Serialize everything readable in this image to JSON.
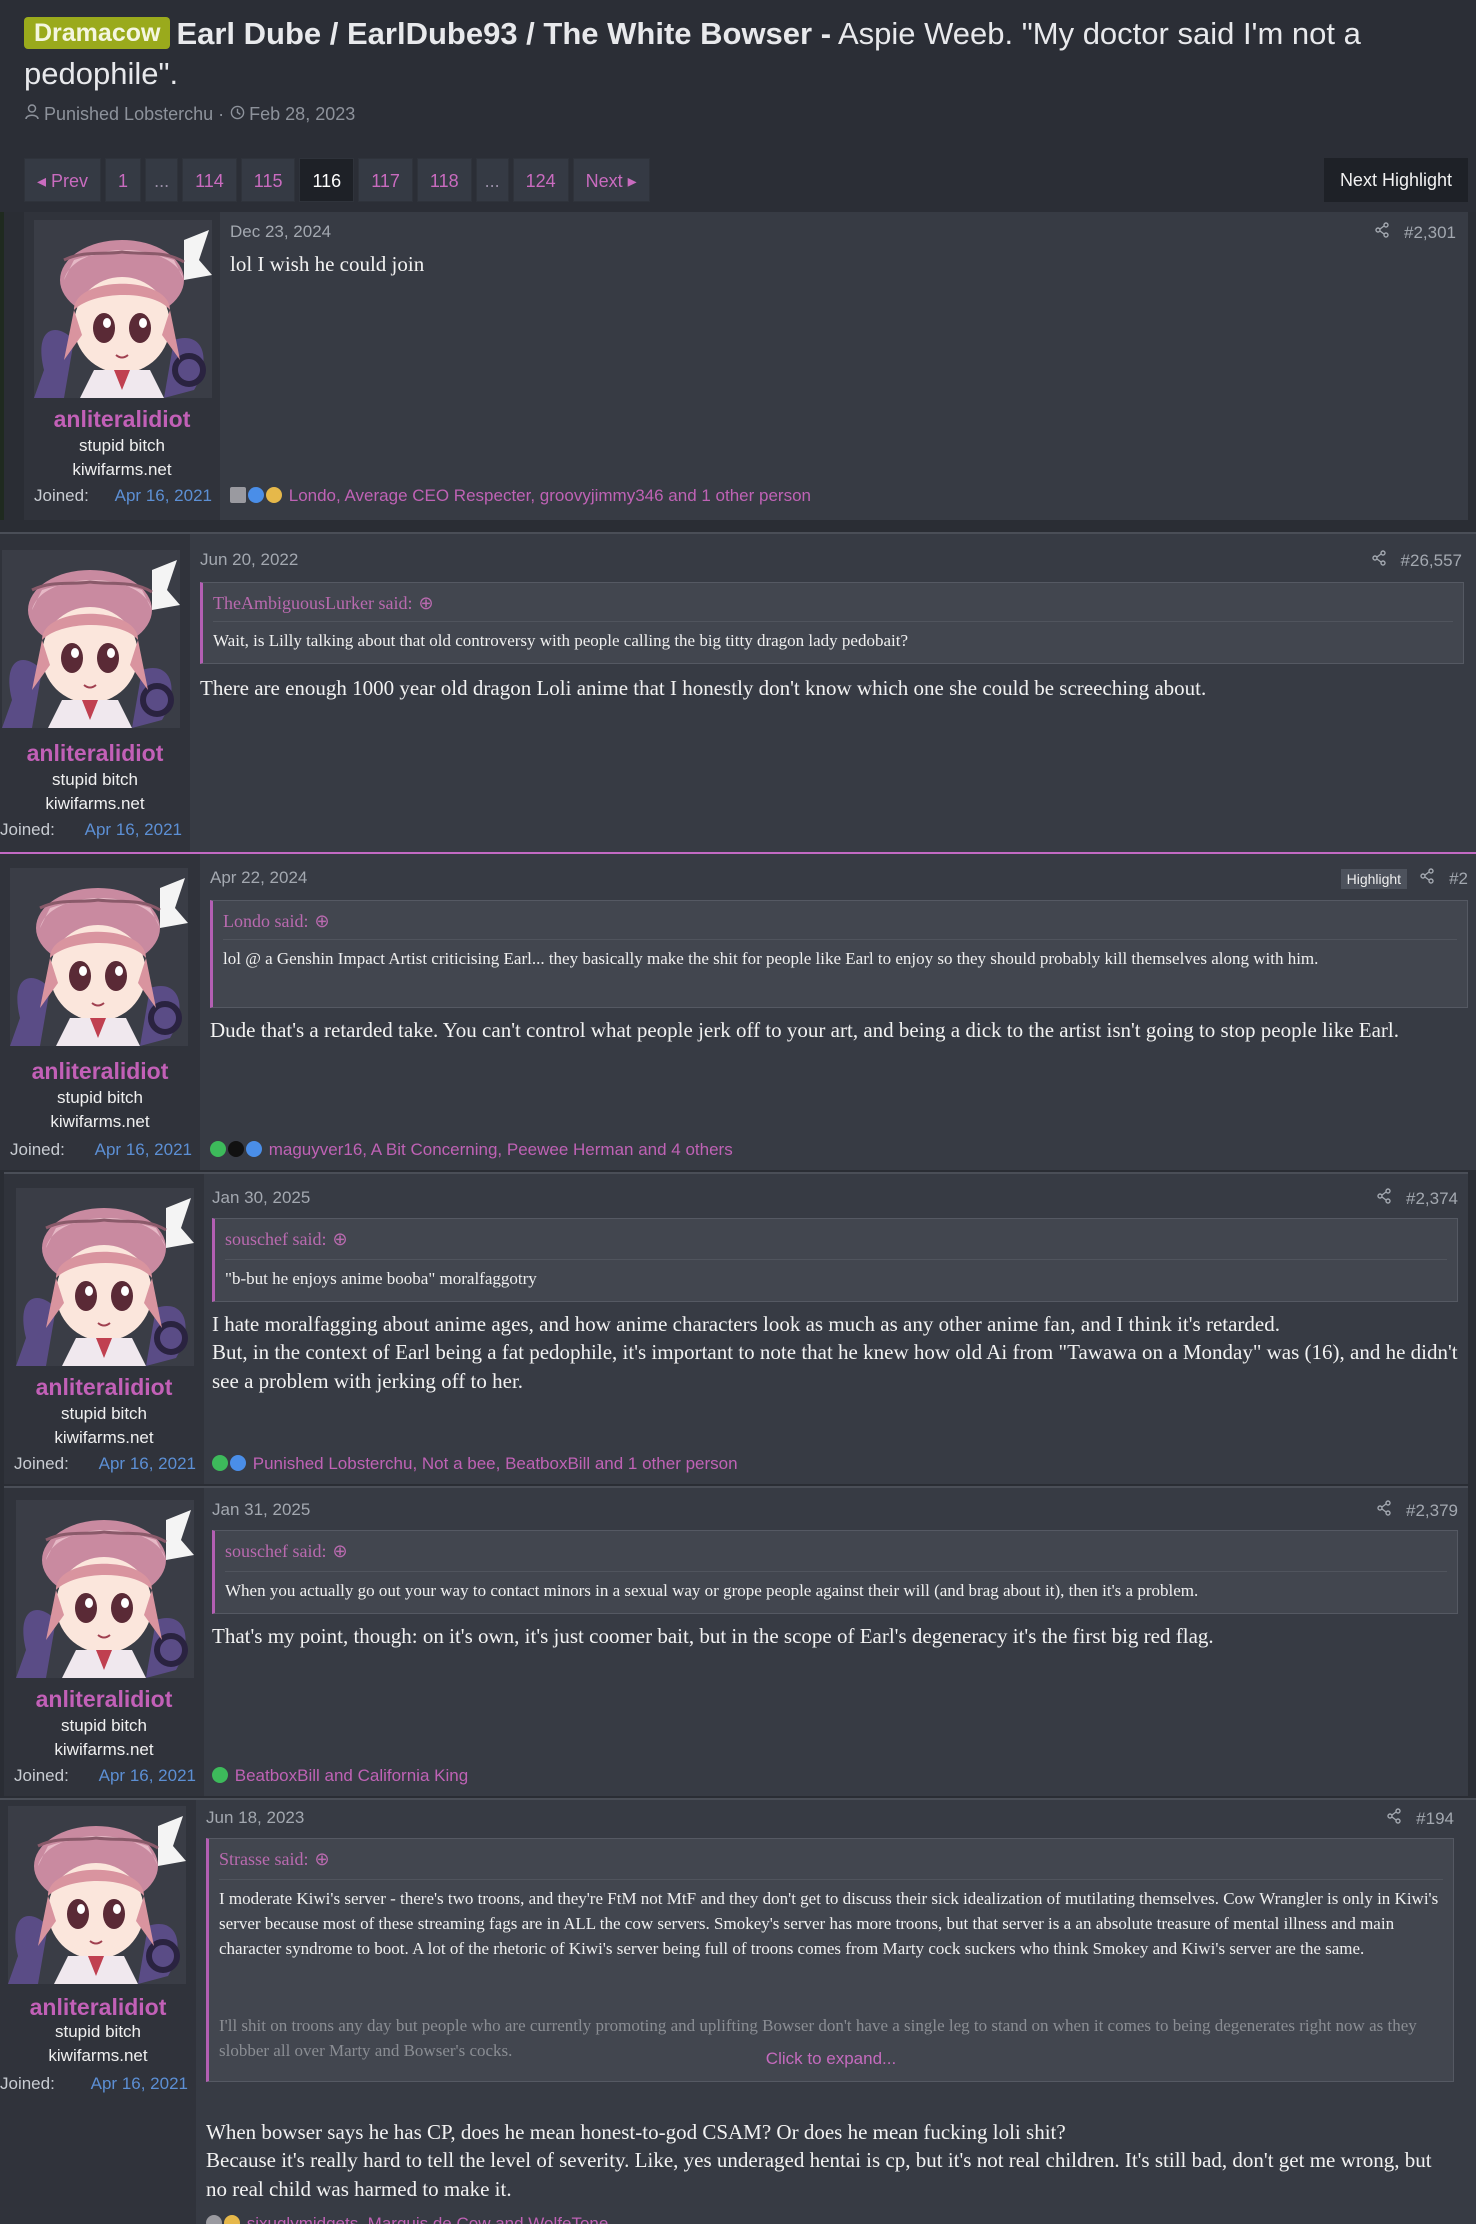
{
  "thread": {
    "prefix": "Dramacow",
    "title_strong": "Earl Dube / EarlDube93 / The White Bowser -",
    "title_rest": " Aspie Weeb. \"My doctor said I'm not a pedophile\".",
    "author": "Punished Lobsterchu",
    "sep": "·",
    "date": "Feb 28, 2023"
  },
  "pager": {
    "prev": "◂ Prev",
    "pages": [
      "1",
      "...",
      "114",
      "115",
      "116",
      "117",
      "118",
      "...",
      "124"
    ],
    "current": "116",
    "next": "Next ▸",
    "next_highlight": "Next Highlight"
  },
  "posts": [
    {
      "user": "anliteralidiot",
      "user_title": "stupid bitch",
      "site": "kiwifarms.net",
      "joined_label": "Joined:",
      "joined": "Apr 16, 2021",
      "date": "Dec 23, 2024",
      "number": "#2,301",
      "body": "lol I wish he could join",
      "reactions": "Londo, Average CEO Respecter, groovyjimmy346 and 1 other person"
    },
    {
      "user": "anliteralidiot",
      "user_title": "stupid bitch",
      "site": "kiwifarms.net",
      "joined_label": "Joined:",
      "joined": "Apr 16, 2021",
      "date": "Jun 20, 2022",
      "number": "#26,557",
      "quote_author": "TheAmbiguousLurker said:",
      "quote": "Wait, is Lilly talking about that old controversy with people calling the big titty dragon lady pedobait?",
      "body": "There are enough 1000 year old dragon Loli anime that I honestly don't know which one she could be screeching about."
    },
    {
      "user": "anliteralidiot",
      "user_title": "stupid bitch",
      "site": "kiwifarms.net",
      "joined_label": "Joined:",
      "joined": "Apr 16, 2021",
      "date": "Apr 22, 2024",
      "number": "#2",
      "badge": "Highlight",
      "quote_author": "Londo said:",
      "quote": "lol @ a Genshin Impact Artist criticising Earl... they basically make the shit for people like Earl to enjoy so they should probably kill themselves along with him.",
      "body": "Dude that's a retarded take. You can't control what people jerk off to your art, and being a dick to the artist isn't going to stop people like Earl.",
      "reactions": "maguyver16, A Bit Concerning, Peewee Herman and 4 others"
    },
    {
      "user": "anliteralidiot",
      "user_title": "stupid bitch",
      "site": "kiwifarms.net",
      "joined_label": "Joined:",
      "joined": "Apr 16, 2021",
      "date": "Jan 30, 2025",
      "number": "#2,374",
      "quote_author": "souschef said:",
      "quote": "\"b-but he enjoys anime booba\" moralfaggotry",
      "body1": "I hate moralfagging about anime ages, and how anime characters look as much as any other anime fan, and I think it's retarded.",
      "body2": "But, in the context of Earl being a fat pedophile, it's important to note that he knew how old Ai from \"Tawawa on a Monday\" was (16), and he didn't see a problem with jerking off to her.",
      "reactions": "Punished Lobsterchu, Not a bee, BeatboxBill and 1 other person"
    },
    {
      "user": "anliteralidiot",
      "user_title": "stupid bitch",
      "site": "kiwifarms.net",
      "joined_label": "Joined:",
      "joined": "Apr 16, 2021",
      "date": "Jan 31, 2025",
      "number": "#2,379",
      "quote_author": "souschef said:",
      "quote": "When you actually go out your way to contact minors in a sexual way or grope people against their will (and brag about it), then it's a problem.",
      "body": "That's my point, though: on it's own, it's just coomer bait, but in the scope of Earl's degeneracy it's the first big red flag.",
      "reactions": "BeatboxBill and California King"
    },
    {
      "user": "anliteralidiot",
      "user_title": "stupid bitch",
      "site": "kiwifarms.net",
      "joined_label": "Joined:",
      "joined": "Apr 16, 2021",
      "date": "Jun 18, 2023",
      "number": "#194",
      "quote_author": "Strasse said:",
      "quote": "I moderate Kiwi's server - there's two troons, and they're FtM not MtF and they don't get to discuss their sick idealization of mutilating themselves. Cow Wrangler is only in Kiwi's server because most of these streaming fags are in ALL the cow servers. Smokey's server has more troons, but that server is a an absolute treasure of mental illness and main character syndrome to boot. A lot of the rhetoric of Kiwi's server being full of troons comes from Marty cock suckers who think Smokey and Kiwi's server are the same.",
      "quote_fade": "I'll shit on troons any day but people who are currently promoting and uplifting Bowser don't have a single leg to stand on when it comes to being degenerates right now as they slobber all over Marty and Bowser's cocks.",
      "expand": "Click to expand...",
      "body1": "When bowser says he has CP, does he mean honest-to-god CSAM? Or does he mean fucking loli shit?",
      "body2": "Because it's really hard to tell the level of severity. Like, yes underaged hentai is cp, but it's not real children. It's still bad, don't get me wrong, but no real child was harmed to make it.",
      "reactions": "sixuglymidgets, Marquis de Cow and WolfeTone"
    }
  ],
  "colors": {
    "accent": "#c260b7",
    "link_blue": "#5c8fd4",
    "prefix_bg": "#9aaa1c"
  }
}
